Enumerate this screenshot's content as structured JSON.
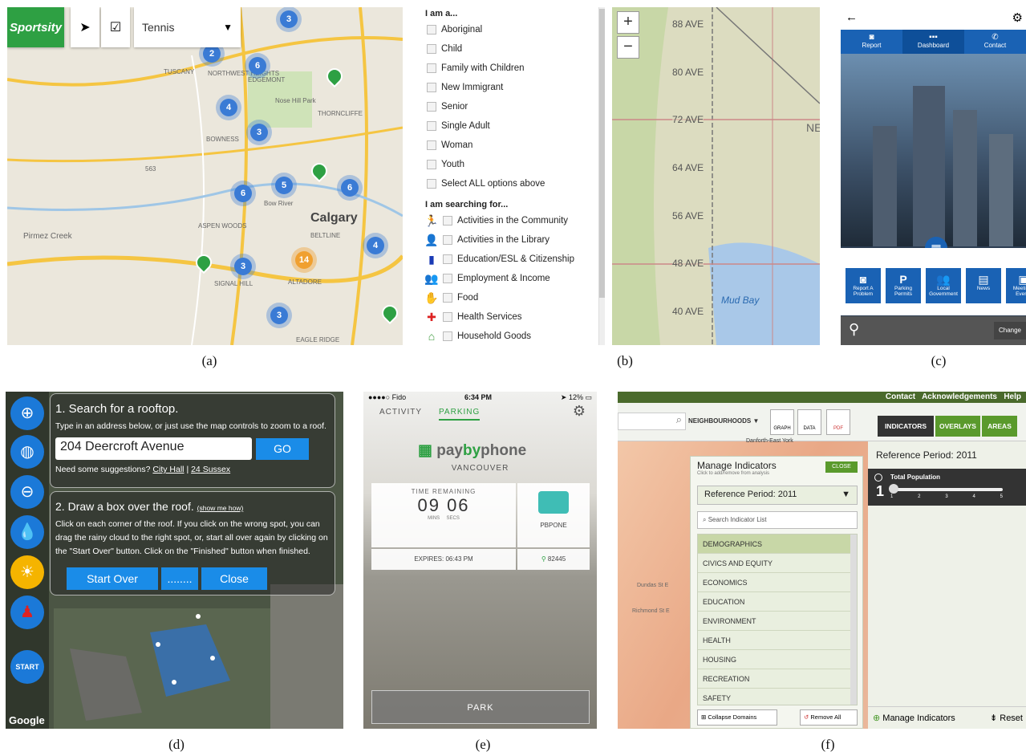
{
  "captions": [
    "(a)",
    "(b)",
    "(c)",
    "(d)",
    "(e)",
    "(f)"
  ],
  "panel_a": {
    "brand": "Sportsity",
    "sport_select": "Tennis",
    "city": "Calgary",
    "map_labels": [
      "TUSCANY",
      "NORTHWEST HEIGHTS",
      "EDGEMONT",
      "Nose Hill Park",
      "THORNCLIFFE",
      "BOWNESS",
      "563",
      "Bow River",
      "ASPEN WOODS",
      "BELTLINE",
      "Pirmez Creek",
      "SIGNAL HILL",
      "ALTADORE",
      "EAGLE RIDGE"
    ],
    "clusters": [
      "3",
      "2",
      "6",
      "4",
      "3",
      "6",
      "5",
      "6",
      "3",
      "14",
      "4",
      "3"
    ]
  },
  "panel_b": {
    "section1": "I am a...",
    "options1": [
      "Aboriginal",
      "Child",
      "Family with Children",
      "New Immigrant",
      "Senior",
      "Single Adult",
      "Woman",
      "Youth",
      "Select ALL options above"
    ],
    "section2": "I am searching for...",
    "options2": [
      "Activities in the Community",
      "Activities in the Library",
      "Education/ESL & Citizenship",
      "Employment & Income",
      "Food",
      "Health Services",
      "Household Goods"
    ],
    "zoom_in": "+",
    "zoom_out": "−",
    "avenues": [
      "88 AVE",
      "80 AVE",
      "72 AVE",
      "64 AVE",
      "56 AVE",
      "48 AVE",
      "40 AVE"
    ],
    "map_labels": [
      "Mud Bay",
      "NE"
    ]
  },
  "panel_c": {
    "nav": [
      "Report",
      "Dashboard",
      "Contact"
    ],
    "tiles": [
      "Report A Problem",
      "Parking Permits",
      "Local Government",
      "News",
      "Meetings Events"
    ],
    "change": "Change"
  },
  "panel_d": {
    "step1_title": "1. Search for a rooftop.",
    "step1_text": "Type in an address below, or just use the map controls to zoom to a roof.",
    "address": "204 Deercroft Avenue",
    "go": "GO",
    "suggest": "Need some suggestions?",
    "link1": "City Hall",
    "sep": "|",
    "link2": "24 Sussex",
    "step2_title": "2. Draw a box over the roof.",
    "show_me": "(show me how)",
    "step2_text": "Click on each corner of the roof. If you click on the wrong spot, you can drag the rainy cloud to the right spot, or, start all over again by clicking on the \"Start Over\" button. Click on the \"Finished\" button when finished.",
    "start_over": "Start Over",
    "dots": "........",
    "close": "Close",
    "start": "START",
    "google": "Google"
  },
  "panel_e": {
    "carrier": "●●●●○ Fido",
    "time": "6:34 PM",
    "battery": "12%",
    "tabs": [
      "ACTIVITY",
      "PARKING"
    ],
    "brand_pre": "pay",
    "brand_mid": "by",
    "brand_post": "phone",
    "city": "VANCOUVER",
    "time_remaining": "TIME REMAINING",
    "hours": "09",
    "mins": "06",
    "mins_label": "MINS",
    "secs_label": "SECS",
    "plate": "PBPONE",
    "expires": "EXPIRES: 06:43 PM",
    "location": "82445",
    "park": "PARK"
  },
  "panel_f": {
    "top_links": [
      "Contact",
      "Acknowledgements",
      "Help"
    ],
    "neigh": "NEIGHBOURHOODS",
    "tools": [
      "GRAPH",
      "DATA",
      "PDF"
    ],
    "tabs": [
      "INDICATORS",
      "OVERLAYS",
      "AREAS"
    ],
    "area_label": "Danforth-East York",
    "manage_title": "Manage Indicators",
    "manage_sub": "Click to add/remove from analysis",
    "close": "CLOSE",
    "period_select": "Reference Period: 2011",
    "search_placeholder": "Search Indicator List",
    "domains": [
      "DEMOGRAPHICS",
      "CIVICS AND EQUITY",
      "ECONOMICS",
      "EDUCATION",
      "ENVIRONMENT",
      "HEALTH",
      "HOUSING",
      "RECREATION",
      "SAFETY"
    ],
    "collapse": "Collapse Domains",
    "remove_all": "Remove All",
    "ref_period": "Reference Period: 2011",
    "indicator": "Total Population",
    "scale": [
      "1",
      "2",
      "3",
      "4",
      "5"
    ],
    "level": "1",
    "manage_btn": "Manage Indicators",
    "reset": "Reset",
    "streets": [
      "Dundas St E",
      "Richmond St E"
    ]
  }
}
